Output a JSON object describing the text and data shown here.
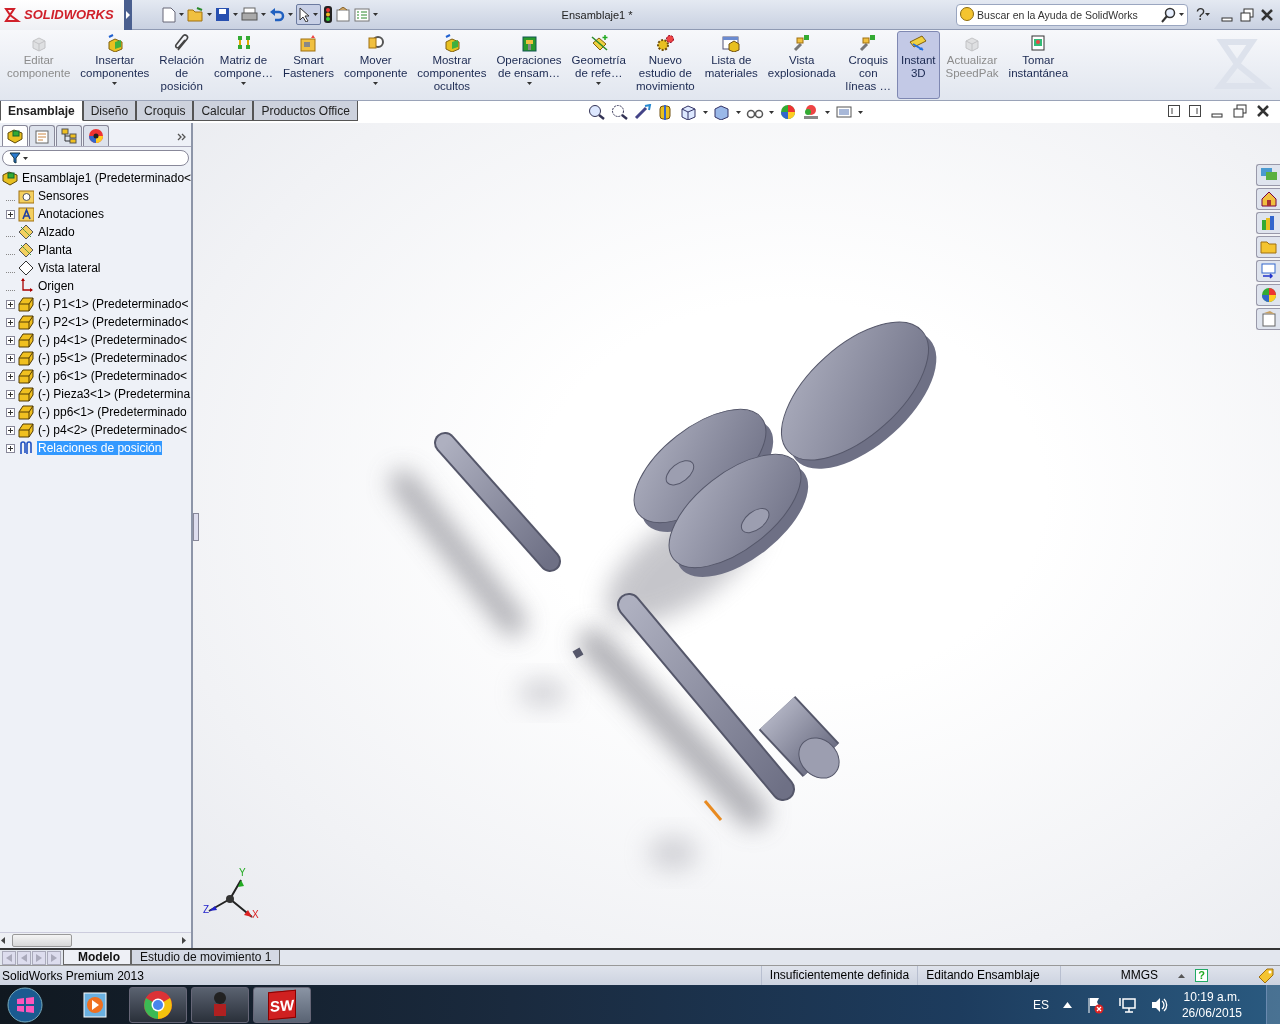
{
  "title_bar": {
    "logo": "SOLIDWORKS",
    "title": "Ensamblaje1 *",
    "search": {
      "placeholder": "Buscar en la Ayuda de SolidWorks"
    },
    "help": "?"
  },
  "command_manager": [
    {
      "label": "Editar\ncomponente",
      "kind": "cube",
      "disabled": true,
      "dropdown": false,
      "selected": false
    },
    {
      "label": "Insertar\ncomponentes",
      "kind": "insert",
      "disabled": false,
      "dropdown": true,
      "selected": false
    },
    {
      "label": "Relación\nde\nposición",
      "kind": "mate",
      "disabled": false,
      "dropdown": false,
      "selected": false
    },
    {
      "label": "Matriz de\ncompone…",
      "kind": "pattern",
      "disabled": false,
      "dropdown": true,
      "selected": false
    },
    {
      "label": "Smart\nFasteners",
      "kind": "fastener",
      "disabled": false,
      "dropdown": false,
      "selected": false
    },
    {
      "label": "Mover\ncomponente",
      "kind": "move",
      "disabled": false,
      "dropdown": true,
      "selected": false
    },
    {
      "label": "Mostrar\ncomponentes\nocultos",
      "kind": "insert",
      "disabled": false,
      "dropdown": false,
      "selected": false
    },
    {
      "label": "Operaciones\nde ensam…",
      "kind": "feature",
      "disabled": false,
      "dropdown": true,
      "selected": false
    },
    {
      "label": "Geometría\nde refe…",
      "kind": "reference",
      "disabled": false,
      "dropdown": true,
      "selected": false
    },
    {
      "label": "Nuevo\nestudio de\nmovimiento",
      "kind": "motion",
      "disabled": false,
      "dropdown": false,
      "selected": false
    },
    {
      "label": "Lista de\nmateriales",
      "kind": "table",
      "disabled": false,
      "dropdown": false,
      "selected": false
    },
    {
      "label": "Vista\nexplosionada",
      "kind": "explode",
      "disabled": false,
      "dropdown": false,
      "selected": false
    },
    {
      "label": "Croquis\ncon\nlíneas …",
      "kind": "explode",
      "disabled": false,
      "dropdown": false,
      "selected": false
    },
    {
      "label": "Instant\n3D",
      "kind": "ruler",
      "disabled": false,
      "dropdown": false,
      "selected": true
    },
    {
      "label": "Actualizar\nSpeedPak",
      "kind": "cube",
      "disabled": true,
      "dropdown": false,
      "selected": false
    },
    {
      "label": "Tomar\ninstantánea",
      "kind": "picture",
      "disabled": false,
      "dropdown": false,
      "selected": false
    }
  ],
  "tabs": [
    {
      "label": "Ensamblaje",
      "selected": true
    },
    {
      "label": "Diseño",
      "selected": false
    },
    {
      "label": "Croquis",
      "selected": false
    },
    {
      "label": "Calcular",
      "selected": false
    },
    {
      "label": "Productos Office",
      "selected": false
    }
  ],
  "feature_tree": {
    "panel_tabs": [
      {
        "selected": true
      },
      {
        "selected": false
      },
      {
        "selected": false
      },
      {
        "selected": false
      }
    ],
    "root": {
      "label": "Ensamblaje1  (Predeterminado<",
      "kind": "assembly",
      "selected": false,
      "expandable": false,
      "children": [
        {
          "label": "Sensores",
          "kind": "sensor",
          "selected": false,
          "expandable": false
        },
        {
          "label": "Anotaciones",
          "kind": "annotation",
          "selected": false,
          "expandable": true
        },
        {
          "label": "Alzado",
          "kind": "plane",
          "selected": false,
          "expandable": false
        },
        {
          "label": "Planta",
          "kind": "plane",
          "selected": false,
          "expandable": false
        },
        {
          "label": "Vista lateral",
          "kind": "plane-outline",
          "selected": false,
          "expandable": false
        },
        {
          "label": "Origen",
          "kind": "origin",
          "selected": false,
          "expandable": false
        },
        {
          "label": "(-) P1<1> (Predeterminado<",
          "kind": "part",
          "selected": false,
          "expandable": true
        },
        {
          "label": "(-) P2<1> (Predeterminado<",
          "kind": "part",
          "selected": false,
          "expandable": true
        },
        {
          "label": "(-) p4<1> (Predeterminado<",
          "kind": "part",
          "selected": false,
          "expandable": true
        },
        {
          "label": "(-) p5<1> (Predeterminado<",
          "kind": "part",
          "selected": false,
          "expandable": true
        },
        {
          "label": "(-) p6<1> (Predeterminado<",
          "kind": "part",
          "selected": false,
          "expandable": true
        },
        {
          "label": "(-) Pieza3<1> (Predetermina",
          "kind": "part",
          "selected": false,
          "expandable": true
        },
        {
          "label": "(-) pp6<1> (Predeterminado",
          "kind": "part",
          "selected": false,
          "expandable": true
        },
        {
          "label": "(-) p4<2> (Predeterminado<",
          "kind": "part",
          "selected": false,
          "expandable": true
        },
        {
          "label": "Relaciones de posición",
          "kind": "mates",
          "selected": true,
          "expandable": true
        }
      ]
    }
  },
  "viewport": {
    "triad": {
      "x": "X",
      "y": "Y",
      "z": "Z"
    }
  },
  "bottom_tabs": [
    {
      "label": "Modelo",
      "selected": true
    },
    {
      "label": "Estudio de movimiento 1",
      "selected": false
    }
  ],
  "status_bar": {
    "product": "SolidWorks Premium 2013",
    "fields": [
      "Insuficientemente definida",
      "Editando Ensamblaje",
      "MMGS"
    ],
    "help": "?"
  },
  "taskbar": {
    "app_badge": "SW",
    "language": "ES",
    "time": "10:19 a.m.",
    "date": "26/06/2015"
  }
}
